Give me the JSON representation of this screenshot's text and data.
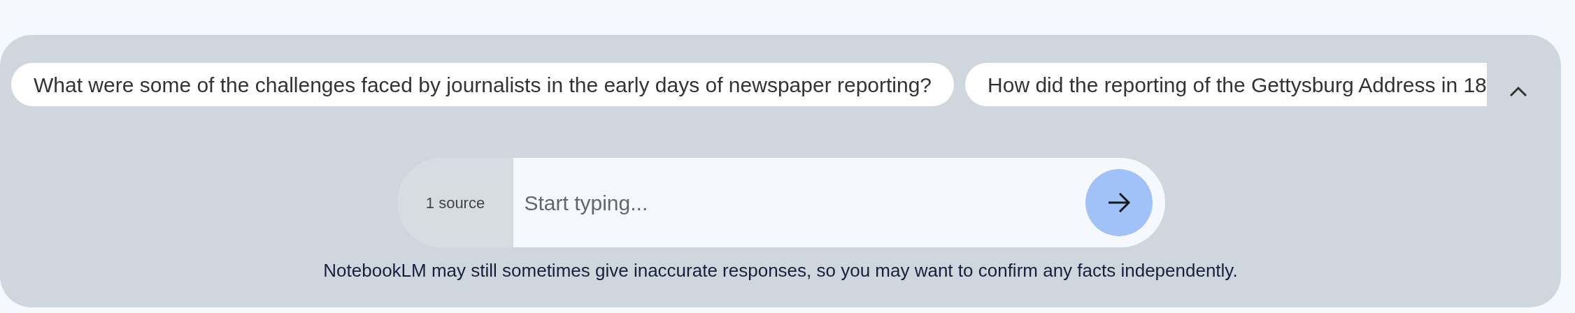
{
  "suggestions": [
    {
      "text": "What were some of the challenges faced by journalists in the early days of newspaper reporting?"
    },
    {
      "text": "How did the reporting of the Gettysburg Address in 18"
    }
  ],
  "composer": {
    "sources": "1 source",
    "placeholder": "Start typing..."
  },
  "disclaimer": "NotebookLM may still sometimes give inaccurate responses, so you may want to confirm any facts independently."
}
